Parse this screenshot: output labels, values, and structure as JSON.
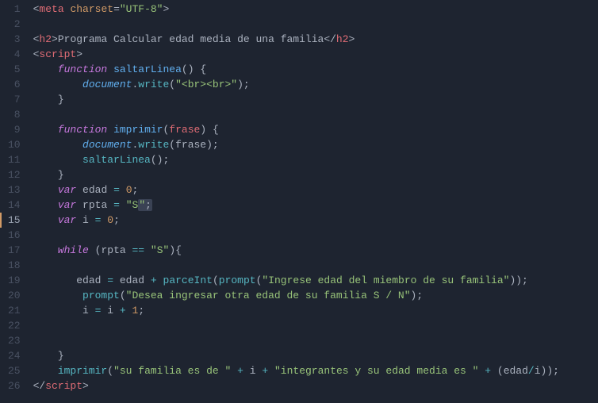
{
  "lines": [
    {
      "num": "1",
      "html": "<span class='t-punc'>&lt;</span><span class='t-tag'>meta</span> <span class='t-attr'>charset</span><span class='t-punc'>=</span><span class='t-str'>\"UTF-8\"</span><span class='t-punc'>&gt;</span>"
    },
    {
      "num": "2",
      "html": ""
    },
    {
      "num": "3",
      "html": "<span class='t-punc'>&lt;</span><span class='t-tag'>h2</span><span class='t-punc'>&gt;</span><span class='t-var'>Programa Calcular edad media de una familia</span><span class='t-punc'>&lt;/</span><span class='t-tag'>h2</span><span class='t-punc'>&gt;</span>"
    },
    {
      "num": "4",
      "html": "<span class='t-punc'>&lt;</span><span class='t-tag'>script</span><span class='t-punc'>&gt;</span>"
    },
    {
      "num": "5",
      "html": "    <span class='t-kw'>function</span> <span class='t-fn'>saltarLinea</span><span class='t-punc'>()</span> <span class='t-punc'>{</span>"
    },
    {
      "num": "6",
      "html": "        <span class='t-obj'>document</span><span class='t-punc'>.</span><span class='t-call'>write</span><span class='t-punc'>(</span><span class='t-str'>\"&lt;br&gt;&lt;br&gt;\"</span><span class='t-punc'>);</span>"
    },
    {
      "num": "7",
      "html": "    <span class='t-punc'>}</span>"
    },
    {
      "num": "8",
      "html": ""
    },
    {
      "num": "9",
      "html": "    <span class='t-kw'>function</span> <span class='t-fn'>imprimir</span><span class='t-punc'>(</span><span class='t-param'>frase</span><span class='t-punc'>)</span> <span class='t-punc'>{</span>"
    },
    {
      "num": "10",
      "html": "        <span class='t-obj'>document</span><span class='t-punc'>.</span><span class='t-call'>write</span><span class='t-punc'>(</span><span class='t-var'>frase</span><span class='t-punc'>);</span>"
    },
    {
      "num": "11",
      "html": "        <span class='t-call'>saltarLinea</span><span class='t-punc'>();</span>"
    },
    {
      "num": "12",
      "html": "    <span class='t-punc'>}</span>"
    },
    {
      "num": "13",
      "html": "    <span class='t-kw'>var</span> <span class='t-var'>edad</span> <span class='t-op'>=</span> <span class='t-num'>0</span><span class='t-punc'>;</span>"
    },
    {
      "num": "14",
      "html": "    <span class='t-kw'>var</span> <span class='t-var'>rpta</span> <span class='t-op'>=</span> <span class='t-str'>\"S</span><span class='sel'><span class='t-str'>\"</span><span class='t-punc'>;</span></span>"
    },
    {
      "num": "15",
      "html": "    <span class='t-kw'>var</span> <span class='t-var'>i</span> <span class='t-op'>=</span> <span class='t-num'>0</span><span class='t-punc'>;</span>",
      "active": true
    },
    {
      "num": "16",
      "html": ""
    },
    {
      "num": "17",
      "html": "    <span class='t-kw'>while</span> <span class='t-punc'>(</span><span class='t-var'>rpta</span> <span class='t-op'>==</span> <span class='t-str'>\"S\"</span><span class='t-punc'>){</span>"
    },
    {
      "num": "18",
      "html": ""
    },
    {
      "num": "19",
      "html": "       <span class='t-var'>edad</span> <span class='t-op'>=</span> <span class='t-var'>edad</span> <span class='t-op'>+</span> <span class='t-call'>parceInt</span><span class='t-punc'>(</span><span class='t-call'>prompt</span><span class='t-punc'>(</span><span class='t-str'>\"Ingrese edad del miembro de su familia\"</span><span class='t-punc'>));</span>"
    },
    {
      "num": "20",
      "html": "        <span class='t-call'>prompt</span><span class='t-punc'>(</span><span class='t-str'>\"Desea ingresar otra edad de su familia S / N\"</span><span class='t-punc'>);</span>"
    },
    {
      "num": "21",
      "html": "        <span class='t-var'>i</span> <span class='t-op'>=</span> <span class='t-var'>i</span> <span class='t-op'>+</span> <span class='t-num'>1</span><span class='t-punc'>;</span>"
    },
    {
      "num": "22",
      "html": ""
    },
    {
      "num": "23",
      "html": ""
    },
    {
      "num": "24",
      "html": "    <span class='t-punc'>}</span>"
    },
    {
      "num": "25",
      "html": "    <span class='t-call'>imprimir</span><span class='t-punc'>(</span><span class='t-str'>\"su familia es de \"</span> <span class='t-op'>+</span> <span class='t-var'>i</span> <span class='t-op'>+</span> <span class='t-str'>\"integrantes y su edad media es \"</span> <span class='t-op'>+</span> <span class='t-punc'>(</span><span class='t-var'>edad</span><span class='t-op'>/</span><span class='t-var'>i</span><span class='t-punc'>));</span>"
    },
    {
      "num": "26",
      "html": "<span class='t-punc'>&lt;/</span><span class='t-tag'>script</span><span class='t-punc'>&gt;</span>"
    }
  ]
}
